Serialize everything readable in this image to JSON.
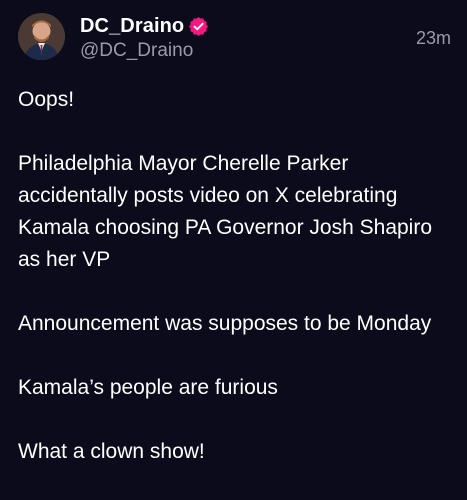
{
  "author": {
    "display_name": "DC_Draino",
    "handle": "@DC_Draino",
    "verified_icon": "verified-badge-icon",
    "verified_color": "#f91880"
  },
  "post": {
    "timestamp": "23m",
    "paragraphs": [
      "Oops!",
      "Philadelphia Mayor Cherelle Parker accidentally posts video on X celebrating Kamala choosing PA Governor Josh Shapiro as her VP",
      "Announcement was supposes to be Monday",
      "Kamala’s people are furious",
      "What a clown show!"
    ]
  },
  "colors": {
    "background": "#0b0b1c",
    "text": "#ffffff",
    "secondary_text": "#9a9aa8"
  }
}
